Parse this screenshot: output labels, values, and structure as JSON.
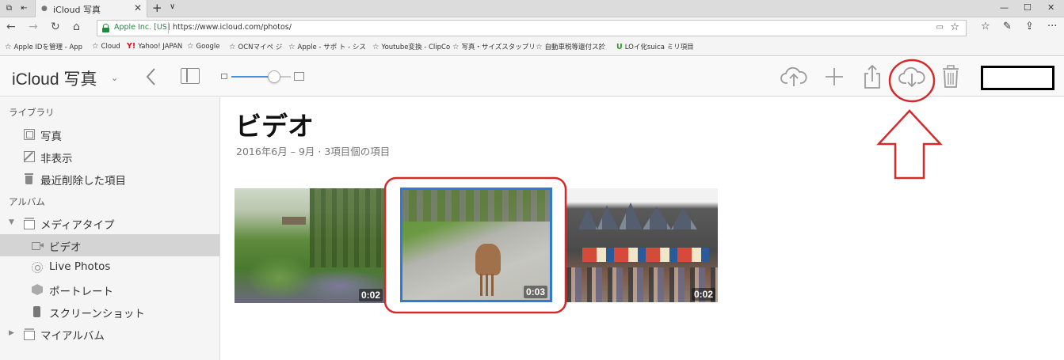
{
  "browser": {
    "tab_title": "iCloud 写真",
    "tab_close": "✕",
    "new_tab": "+",
    "tab_menu": "∨",
    "window_minimize": "—",
    "window_maximize": "☐",
    "window_close": "✕",
    "org_label": "Apple Inc. [US]",
    "url": "https://www.icloud.com/photos/",
    "favorites": [
      {
        "label": "Apple IDを管理 - App",
        "icon": "star"
      },
      {
        "label": "Cloud",
        "icon": "star"
      },
      {
        "label": "Yahoo! JAPAN",
        "icon": "Y!"
      },
      {
        "label": "Google",
        "icon": "star"
      },
      {
        "label": "OCNマイペ ジ",
        "icon": "star"
      },
      {
        "label": "Apple - サポ ト - シス",
        "icon": "star"
      },
      {
        "label": "Youtube変換 - ClipCo",
        "icon": "star"
      },
      {
        "label": "写真・サイズスタップリ",
        "icon": "star"
      },
      {
        "label": "自動車税等還付ス於",
        "icon": "star"
      },
      {
        "label": "LOイ化suica ミリ項目",
        "icon": "U"
      }
    ]
  },
  "app": {
    "title": "iCloud 写真",
    "title_chevron": "⌄",
    "colors": {
      "accent": "#4a90e2",
      "selection_border": "#2f7ad6",
      "annotation_red": "#d42a2a",
      "sidebar_bg": "#f5f5f5",
      "sidebar_selected": "#d4d4d4"
    },
    "zoom_level": 0.72
  },
  "sidebar": {
    "library_heading": "ライブラリ",
    "library_items": [
      {
        "label": "写真",
        "icon": "photos-icon"
      },
      {
        "label": "非表示",
        "icon": "hidden-icon"
      },
      {
        "label": "最近削除した項目",
        "icon": "trash-icon"
      }
    ],
    "albums_heading": "アルバム",
    "media_types": {
      "label": "メディアタイプ",
      "icon": "album-icon",
      "expanded": true
    },
    "media_items": [
      {
        "label": "ビデオ",
        "icon": "video-icon",
        "selected": true
      },
      {
        "label": "Live Photos",
        "icon": "live-photos-icon",
        "selected": false
      },
      {
        "label": "ポートレート",
        "icon": "portrait-icon",
        "selected": false
      },
      {
        "label": "スクリーンショット",
        "icon": "screenshot-icon",
        "selected": false
      }
    ],
    "my_albums": {
      "label": "マイアルバム",
      "icon": "album-icon",
      "expanded": false
    }
  },
  "main": {
    "title": "ビデオ",
    "subtitle": "2016年6月 – 9月 · 3項目個の項目",
    "videos": [
      {
        "duration": "0:02",
        "selected": false
      },
      {
        "duration": "0:03",
        "selected": true
      },
      {
        "duration": "0:02",
        "selected": false
      }
    ]
  }
}
